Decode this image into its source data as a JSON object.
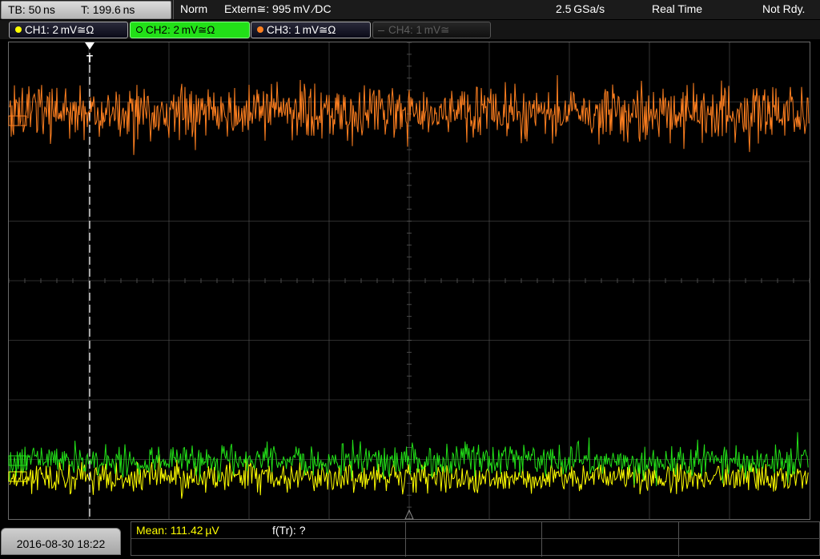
{
  "timebase": {
    "tb_label": "TB: 50 ns",
    "trigger_time_label": "T: 199.6 ns"
  },
  "status": {
    "mode": "Norm",
    "trigger": "Extern≅: 995 mV ∕DC",
    "sample_rate": "2.5 GSa/s",
    "acquisition": "Real Time",
    "ready_state": "Not Rdy."
  },
  "channels": [
    {
      "label": "CH1: 2 mV≅Ω",
      "color": "#ffff00",
      "state": "on"
    },
    {
      "label": "CH2: 2 mV≅Ω",
      "color": "#22e018",
      "state": "selected"
    },
    {
      "label": "CH3: 1 mV≅Ω",
      "color": "#ff8020",
      "state": "on"
    },
    {
      "label": "CH4: 1 mV≅",
      "color": "#5c5c5c",
      "state": "off"
    }
  ],
  "measurements": {
    "mean": "Mean: 111.42 µV",
    "freq": "f(Tr): ?"
  },
  "datetime": "2016-08-30 18:22",
  "trigger_marker": "T",
  "colors": {
    "grid": "#5a5a5a",
    "background": "#000000",
    "trigger_line": "#ffffff"
  }
}
